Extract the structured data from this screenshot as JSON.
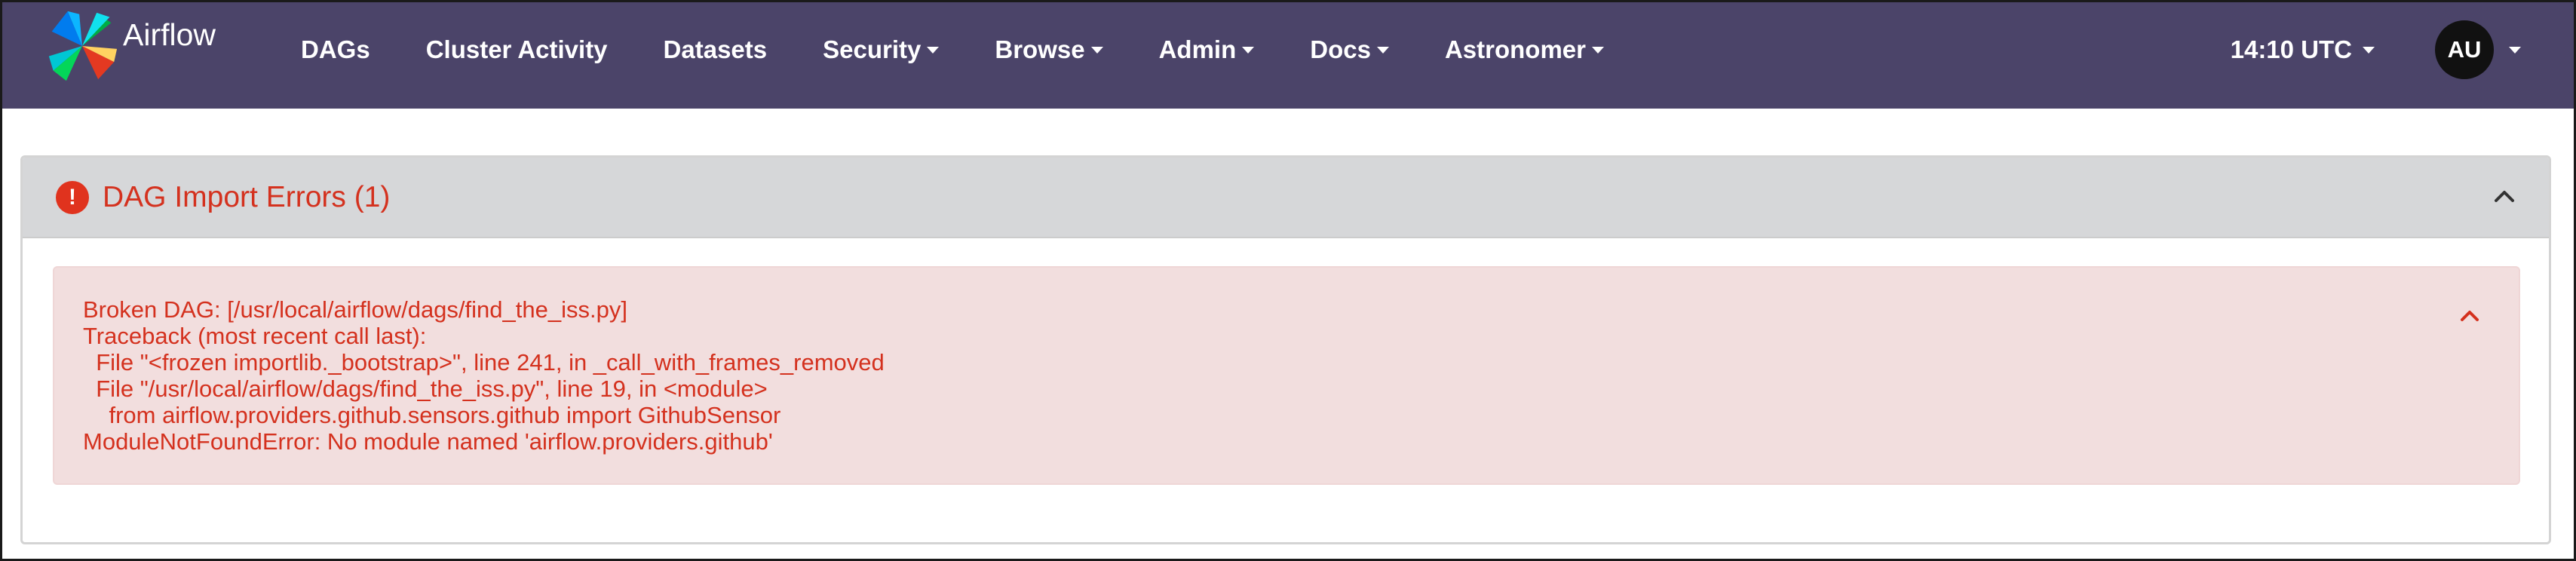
{
  "navbar": {
    "brand": "Airflow",
    "items": [
      {
        "label": "DAGs",
        "dropdown": false
      },
      {
        "label": "Cluster Activity",
        "dropdown": false
      },
      {
        "label": "Datasets",
        "dropdown": false
      },
      {
        "label": "Security",
        "dropdown": true
      },
      {
        "label": "Browse",
        "dropdown": true
      },
      {
        "label": "Admin",
        "dropdown": true
      },
      {
        "label": "Docs",
        "dropdown": true
      },
      {
        "label": "Astronomer",
        "dropdown": true
      }
    ],
    "time": "14:10 UTC",
    "avatar": "AU"
  },
  "panel": {
    "title": "DAG Import Errors (1)",
    "error_lines": [
      "Broken DAG: [/usr/local/airflow/dags/find_the_iss.py]",
      "Traceback (most recent call last):",
      "  File \"<frozen importlib._bootstrap>\", line 241, in _call_with_frames_removed",
      "  File \"/usr/local/airflow/dags/find_the_iss.py\", line 19, in <module>",
      "    from airflow.providers.github.sensors.github import GithubSensor",
      "ModuleNotFoundError: No module named 'airflow.providers.github'"
    ]
  },
  "colors": {
    "navbar_bg": "#4b4469",
    "error_red": "#d4311e",
    "alert_bg": "#f2dede",
    "panel_header_bg": "#d6d7d9"
  }
}
